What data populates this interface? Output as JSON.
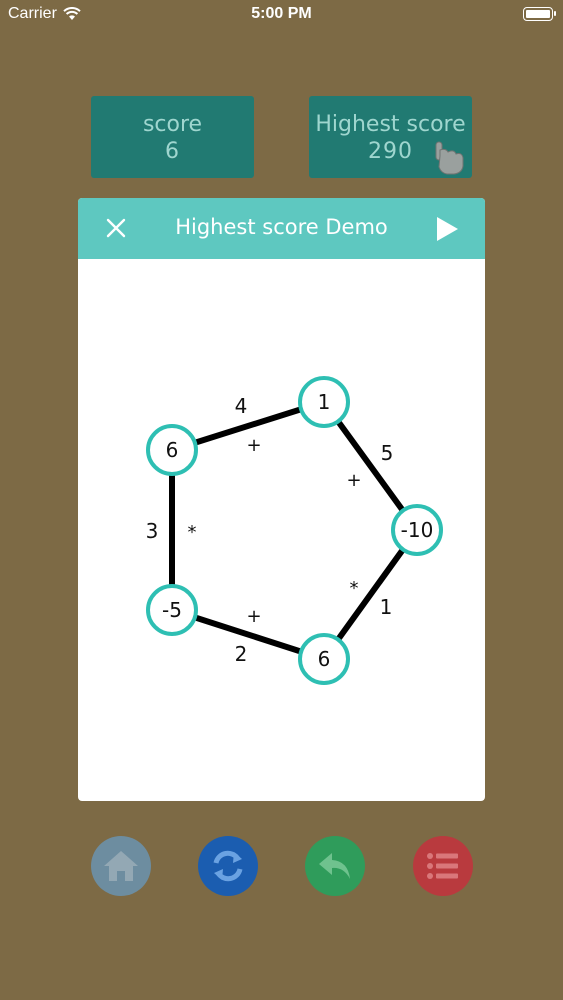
{
  "status_bar": {
    "carrier": "Carrier",
    "time": "5:00 PM"
  },
  "score": {
    "label": "score",
    "value": "6"
  },
  "highest": {
    "label": "Highest score",
    "value": "290"
  },
  "dialog": {
    "title": "Highest score Demo"
  },
  "graph": {
    "nodes": [
      "1",
      "-10",
      "6",
      "-5",
      "6"
    ],
    "edge_numbers": [
      "4",
      "5",
      "1",
      "2",
      "3"
    ],
    "operators": [
      "+",
      "+",
      "*",
      "+",
      "*"
    ]
  },
  "colors": {
    "background": "#7d6a45",
    "score_box": "#217a72",
    "header": "#5ec8c0",
    "node_ring": "#2ebfb3"
  },
  "icons": [
    "wifi-icon",
    "battery-icon",
    "hand-pointer-icon",
    "close-icon",
    "play-icon",
    "home-icon",
    "refresh-icon",
    "undo-icon",
    "menu-icon"
  ]
}
